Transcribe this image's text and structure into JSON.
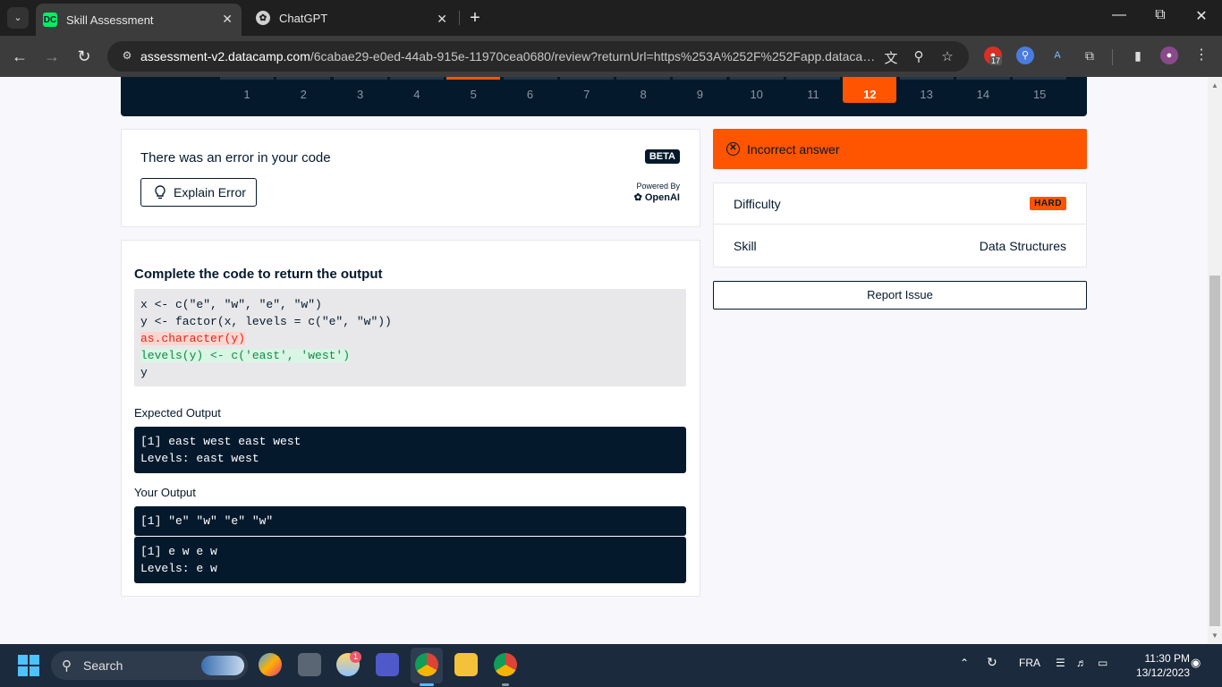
{
  "browser": {
    "tabs": [
      {
        "title": "Skill Assessment",
        "active": true
      },
      {
        "title": "ChatGPT",
        "active": false
      }
    ],
    "url_host": "assessment-v2.datacamp.com",
    "url_rest": "/6cabae29-e0ed-44ab-915e-11970cea0680/review?returnUrl=https%253A%252F%252Fapp.datacamp...",
    "extension_badge": "17"
  },
  "question_nav": {
    "numbers": [
      "1",
      "2",
      "3",
      "4",
      "5",
      "6",
      "7",
      "8",
      "9",
      "10",
      "11",
      "12",
      "13",
      "14",
      "15"
    ],
    "current": "12",
    "visited": "5"
  },
  "error_card": {
    "title": "There was an error in your code",
    "badge": "BETA",
    "explain_label": "Explain Error",
    "powered_by": "Powered By",
    "powered_brand": "OpenAI"
  },
  "question": {
    "title": "Complete the code to return the output",
    "code_lines": [
      {
        "text": "x <- c(\"e\", \"w\", \"e\", \"w\")",
        "kind": "normal"
      },
      {
        "text": "y <- factor(x, levels = c(\"e\", \"w\"))",
        "kind": "normal"
      },
      {
        "text": "as.character(y)",
        "kind": "del"
      },
      {
        "text": "levels(y) <- c('east', 'west')",
        "kind": "add"
      },
      {
        "text": "y",
        "kind": "normal"
      }
    ],
    "expected_label": "Expected Output",
    "expected_lines": [
      "[1] east west east west",
      "Levels: east west"
    ],
    "your_label": "Your Output",
    "your_output_1": [
      "[1] \"e\" \"w\" \"e\" \"w\""
    ],
    "your_output_2": [
      "[1] e w e w",
      "Levels: e w"
    ]
  },
  "result": {
    "status": "Incorrect answer",
    "difficulty_label": "Difficulty",
    "difficulty_value": "HARD",
    "skill_label": "Skill",
    "skill_value": "Data Structures",
    "report_label": "Report Issue"
  },
  "taskbar": {
    "search_placeholder": "Search",
    "language": "FRA",
    "time": "11:30 PM",
    "date": "13/12/2023",
    "weather_badge": "1"
  },
  "colors": {
    "brand_navy": "#05192d",
    "accent_orange": "#ff5400",
    "datacamp_green": "#03ef62"
  }
}
